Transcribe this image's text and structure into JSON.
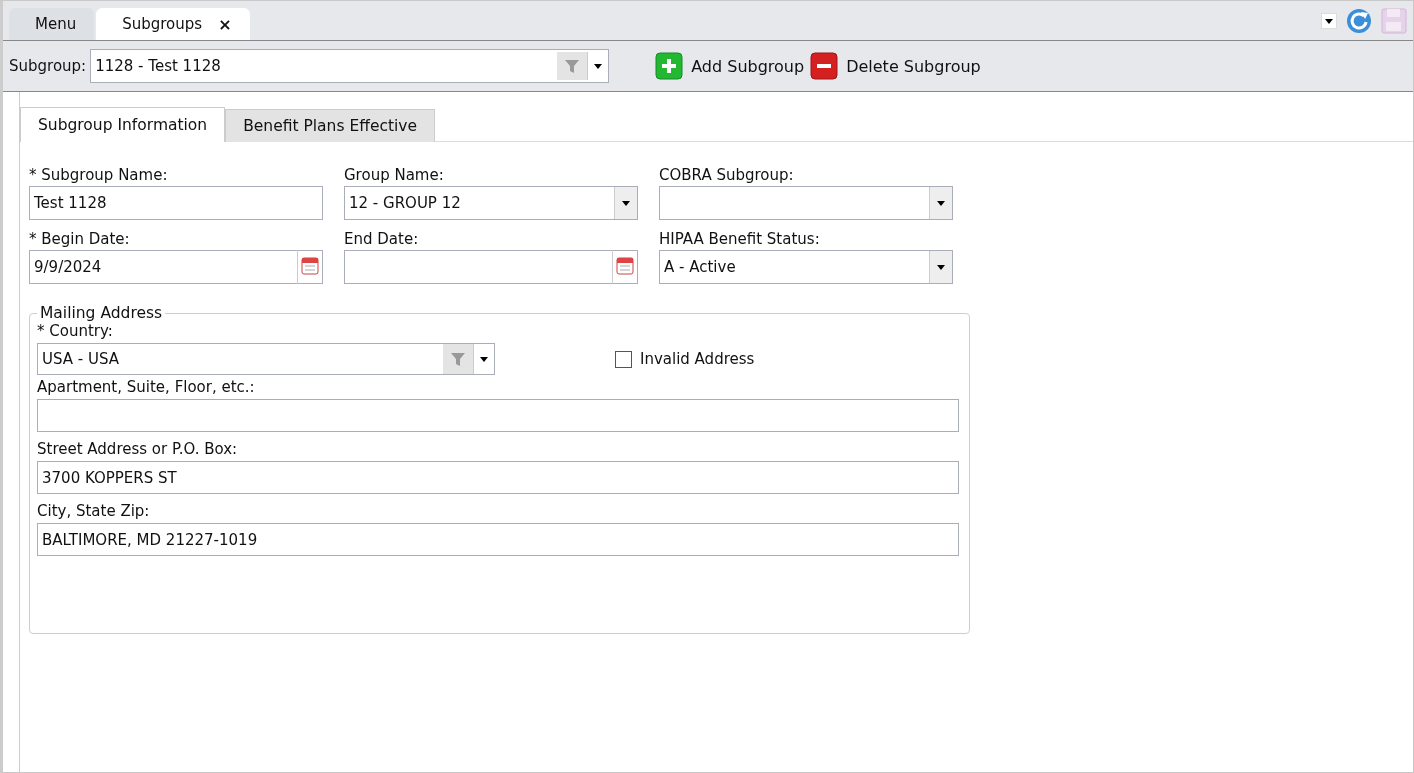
{
  "doc_tabs": [
    {
      "label": "Menu",
      "selected": false
    },
    {
      "label": "Subgroups",
      "selected": true,
      "close": "×"
    }
  ],
  "toolbar": {
    "label": "Subgroup:",
    "value": "1128 - Test 1128",
    "add": "Add Subgroup",
    "delete": "Delete Subgroup"
  },
  "tabs": [
    {
      "label": "Subgroup Information",
      "selected": true
    },
    {
      "label": "Benefit Plans Effective",
      "selected": false
    }
  ],
  "fields": [
    {
      "label": "* Subgroup Name:",
      "kind": "text",
      "value": "Test 1128"
    },
    {
      "label": "Group Name:",
      "kind": "dropdown",
      "value": "12 - GROUP 12"
    },
    {
      "label": "COBRA Subgroup:",
      "kind": "dropdown"
    },
    {
      "label": "* Begin Date:",
      "kind": "date",
      "value": "9/9/2024"
    },
    {
      "label": "End Date:",
      "kind": "date"
    },
    {
      "label": "HIPAA Benefit Status:",
      "kind": "dropdown",
      "value": "A - Active"
    }
  ],
  "mailing_address": {
    "title": "Mailing Address",
    "country_label": "* Country:",
    "country": "USA - USA",
    "invalid_address": {
      "label": "Invalid Address",
      "checked": false
    },
    "lines": [
      {
        "label": "Apartment, Suite, Floor, etc.:"
      },
      {
        "label": "Street Address or P.O. Box:",
        "value": "3700 KOPPERS ST"
      },
      {
        "label": "City, State Zip:",
        "value": "BALTIMORE, MD 21227-1019"
      }
    ]
  }
}
